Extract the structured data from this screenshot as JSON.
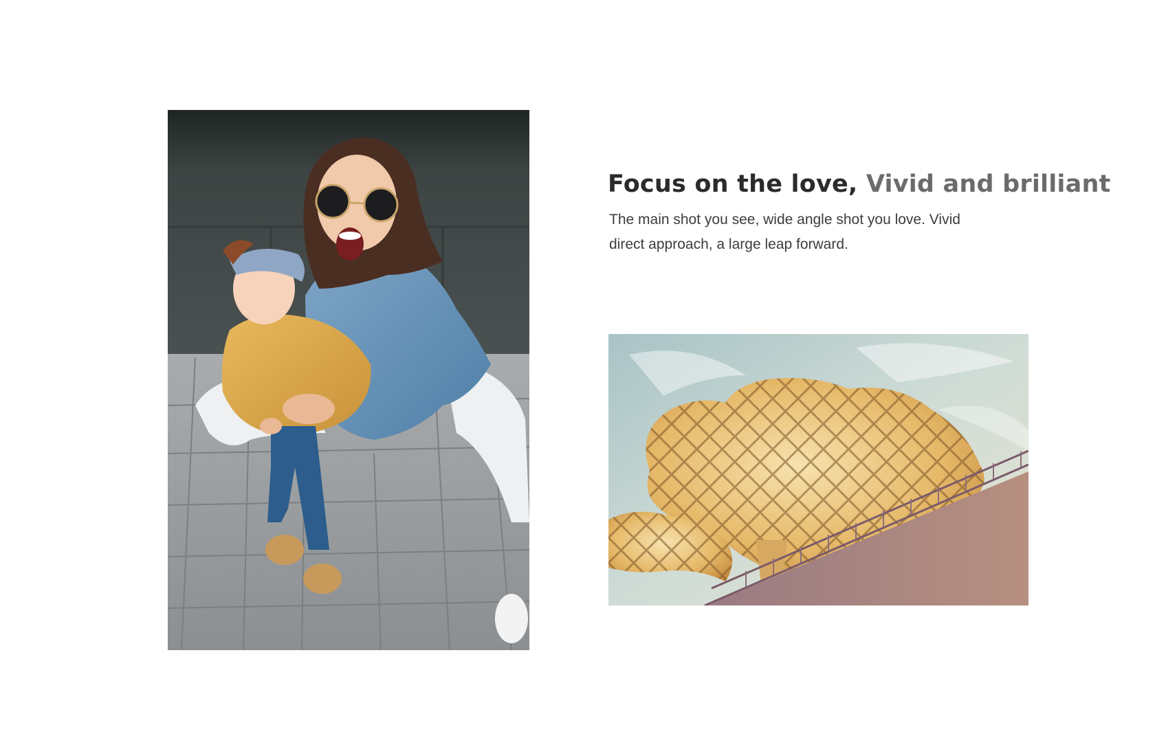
{
  "feature": {
    "headline_lead": "Focus on the love,",
    "headline_accent": "Vivid and brilliant",
    "body": "The main shot you see, wide angle shot you love. Vivid direct approach, a large leap forward."
  },
  "images": {
    "portrait": {
      "subject": "mother-and-baby-photo"
    },
    "landscape": {
      "subject": "wooden-lattice-structure-photo"
    }
  },
  "colors": {
    "headline_lead": "#2b2b2b",
    "headline_accent": "#6b6b6b",
    "body_text": "#3c3c3c",
    "background": "#ffffff"
  }
}
